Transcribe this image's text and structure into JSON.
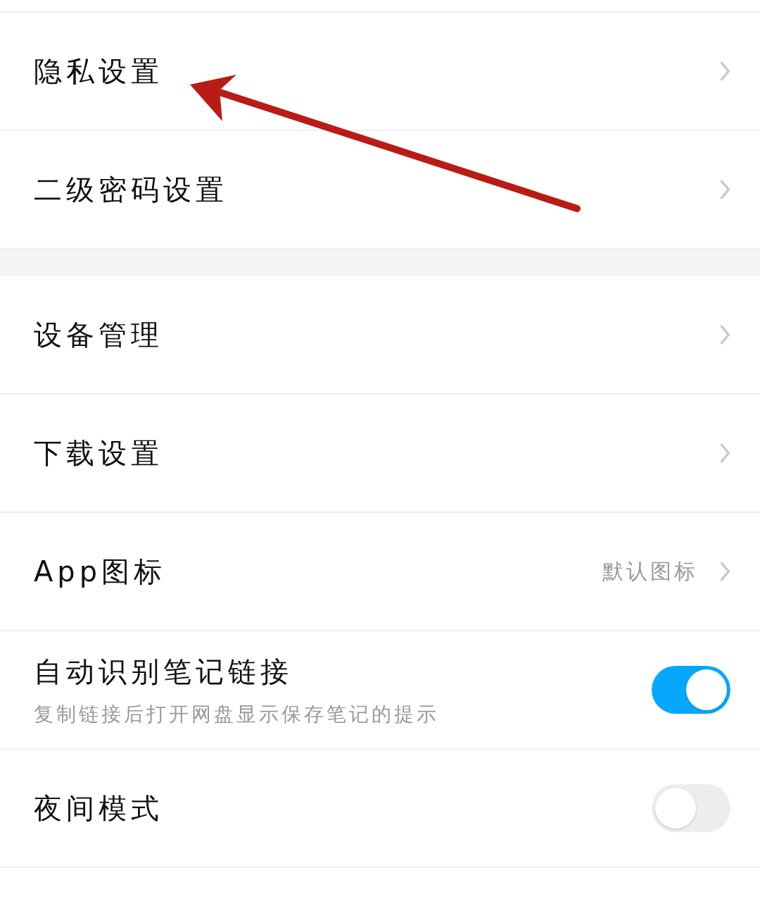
{
  "groups": [
    {
      "items": [
        {
          "kind": "link",
          "title": "隐私设置"
        },
        {
          "kind": "link",
          "title": "二级密码设置"
        }
      ]
    },
    {
      "items": [
        {
          "kind": "link",
          "title": "设备管理"
        },
        {
          "kind": "link",
          "title": "下载设置"
        },
        {
          "kind": "link",
          "title": "App图标",
          "value": "默认图标"
        },
        {
          "kind": "toggle",
          "title": "自动识别笔记链接",
          "subtitle": "复制链接后打开网盘显示保存笔记的提示",
          "on": true
        },
        {
          "kind": "toggle",
          "title": "夜间模式",
          "on": false
        },
        {
          "kind": "blank"
        }
      ]
    }
  ]
}
